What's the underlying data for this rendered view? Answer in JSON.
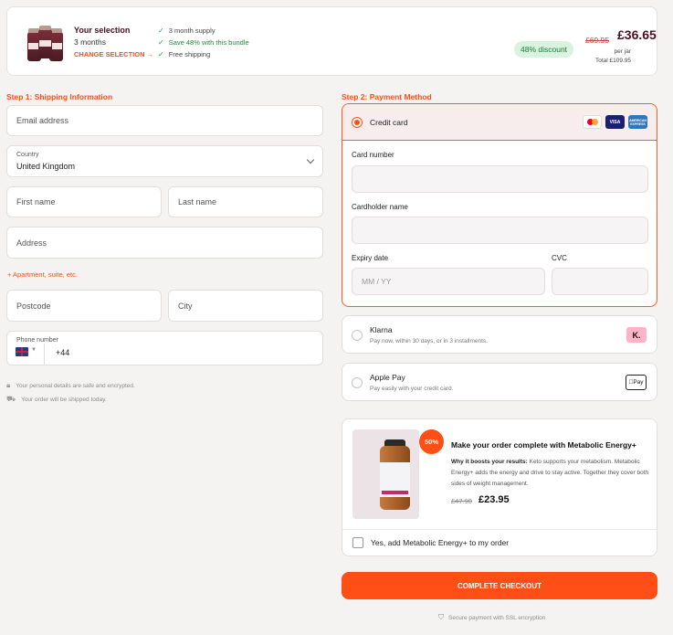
{
  "summary": {
    "title": "Your selection",
    "qty": "3 months",
    "change": "CHANGE SELECTION →",
    "features": [
      "3 month supply",
      "Save 48% with this bundle",
      "Free shipping"
    ],
    "product_label": "KETO",
    "discount": "48% discount",
    "old_price": "£69.95",
    "price": "£36.65",
    "per": "per jar",
    "total": "Total £109.95"
  },
  "shipping": {
    "heading": "Step 1: Shipping Information",
    "email_placeholder": "Email address",
    "country_label": "Country",
    "country_value": "United Kingdom",
    "first_name_placeholder": "First name",
    "last_name_placeholder": "Last name",
    "address_placeholder": "Address",
    "apartment_link": "+ Apartment, suite, etc.",
    "postcode_placeholder": "Postcode",
    "city_placeholder": "City",
    "phone_label": "Phone number",
    "phone_code": "+44",
    "note_secure": "Your personal details are safe and encrypted.",
    "note_shipping": "Your order will be shipped today."
  },
  "payment": {
    "heading": "Step 2: Payment Method",
    "credit_card": "Credit card",
    "card_logos": [
      "mastercard",
      "VISA",
      "AMERICAN EXPRESS"
    ],
    "card_number_label": "Card number",
    "cardholder_label": "Cardholder name",
    "expiry_label": "Expiry date",
    "expiry_placeholder": "MM / YY",
    "cvc_label": "CVC",
    "klarna_title": "Klarna",
    "klarna_desc": "Pay now, within 30 days, or in 3 installments.",
    "klarna_logo": "K.",
    "apple_title": "Apple Pay",
    "apple_desc": "Pay easily with your credit card.",
    "apple_logo": "Pay"
  },
  "upsell": {
    "badge": "50%",
    "title": "Make your order complete with Metabolic Energy+",
    "why_label": "Why it boosts your results:",
    "why_text": " Keto supports your metabolism. Metabolic Energy+ adds the energy and drive to stay active. Together they cover both sides of weight management.",
    "old_price": "£47.90",
    "price": "£23.95",
    "checkbox_label": "Yes, add Metabolic Energy+ to my order",
    "bottle_text": "metabolic energy+"
  },
  "checkout": {
    "button": "COMPLETE CHECKOUT",
    "secure": "Secure payment with SSL encryption"
  }
}
